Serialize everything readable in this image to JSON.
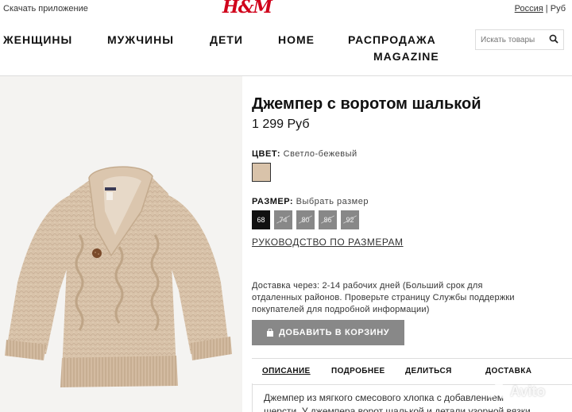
{
  "topbar": {
    "app_link": "Скачать приложение",
    "logo": "H&M",
    "region": "Россия",
    "currency": "Руб"
  },
  "nav": {
    "items": [
      "ЖЕНЩИНЫ",
      "МУЖЧИНЫ",
      "ДЕТИ",
      "HOME",
      "РАСПРОДАЖА",
      "MAGAZINE"
    ]
  },
  "search": {
    "placeholder": "Искать товары"
  },
  "product": {
    "title": "Джемпер с воротом шалькой",
    "price": "1 299 Руб",
    "color_label": "ЦВЕТ:",
    "color_value": "Светло-бежевый",
    "swatch_color": "#d9c3aa",
    "size_label": "РАЗМЕР:",
    "size_hint": "Выбрать размер",
    "sizes": [
      "68",
      "74",
      "80",
      "86",
      "92"
    ],
    "selected_size": "68",
    "size_guide": "РУКОВОДСТВО ПО РАЗМЕРАМ",
    "delivery_line1": "Доставка через: 2-14 рабочих дней (Больший срок для",
    "delivery_line2": "отдаленных районов. Проверьте страницу Службы поддержки",
    "delivery_line3": "покупателей для подробной информации)",
    "add_to_cart": "ДОБАВИТЬ В КОРЗИНУ"
  },
  "tabs": [
    "ОПИСАНИЕ",
    "ПОДРОБНЕЕ",
    "ДЕЛИТЬСЯ",
    "ДОСТАВКА"
  ],
  "description": {
    "line1": "Джемпер из мягкого смесового хлопка с добавлением",
    "line2": "шерсти. У джемпера ворот шалькой и детали узорной вязки"
  },
  "watermark": "Avito",
  "colors": {
    "accent_red": "#d0021b",
    "button_gray": "#888888",
    "sweater_beige": "#d9c3aa"
  }
}
